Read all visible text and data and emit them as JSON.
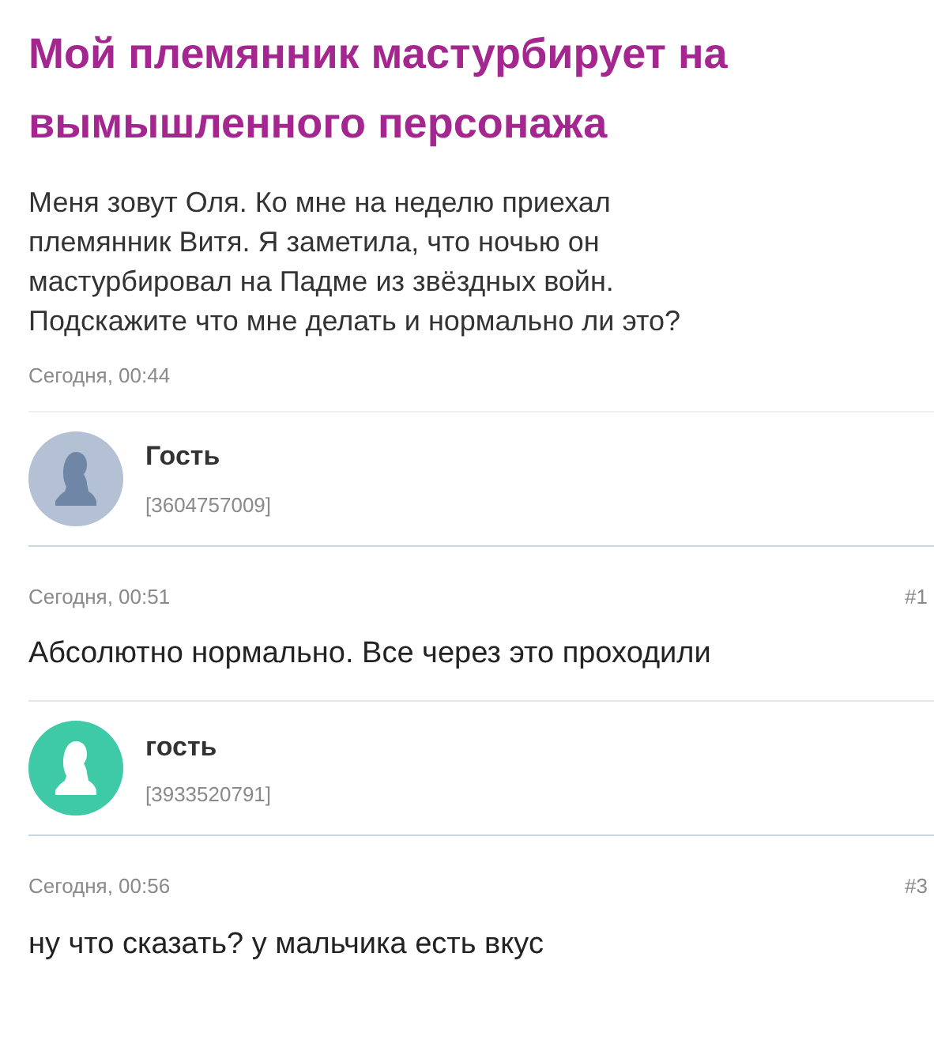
{
  "post": {
    "title": "Мой племянник мастурбирует на вымышленного персонажа",
    "text": "Меня зовут Оля. Ко мне на неделю приехал племянник Витя. Я заметила, что ночью он мастурбировал на Падме из звёздных войн. Подскажите что мне делать и нормально ли это?",
    "date": "Сегодня, 00:44"
  },
  "replies": [
    {
      "author": "Гость",
      "user_id": "[3604757009]",
      "color": "#b4c0d3",
      "date": "Сегодня, 00:51",
      "number": "#1",
      "text": "Абсолютно нормально. Все через это проходили"
    },
    {
      "author": "гость",
      "user_id": "[3933520791]",
      "color": "#3ec9a7",
      "date": "Сегодня, 00:56",
      "number": "#3",
      "text": "ну что сказать? у мальчика есть вкус"
    }
  ]
}
